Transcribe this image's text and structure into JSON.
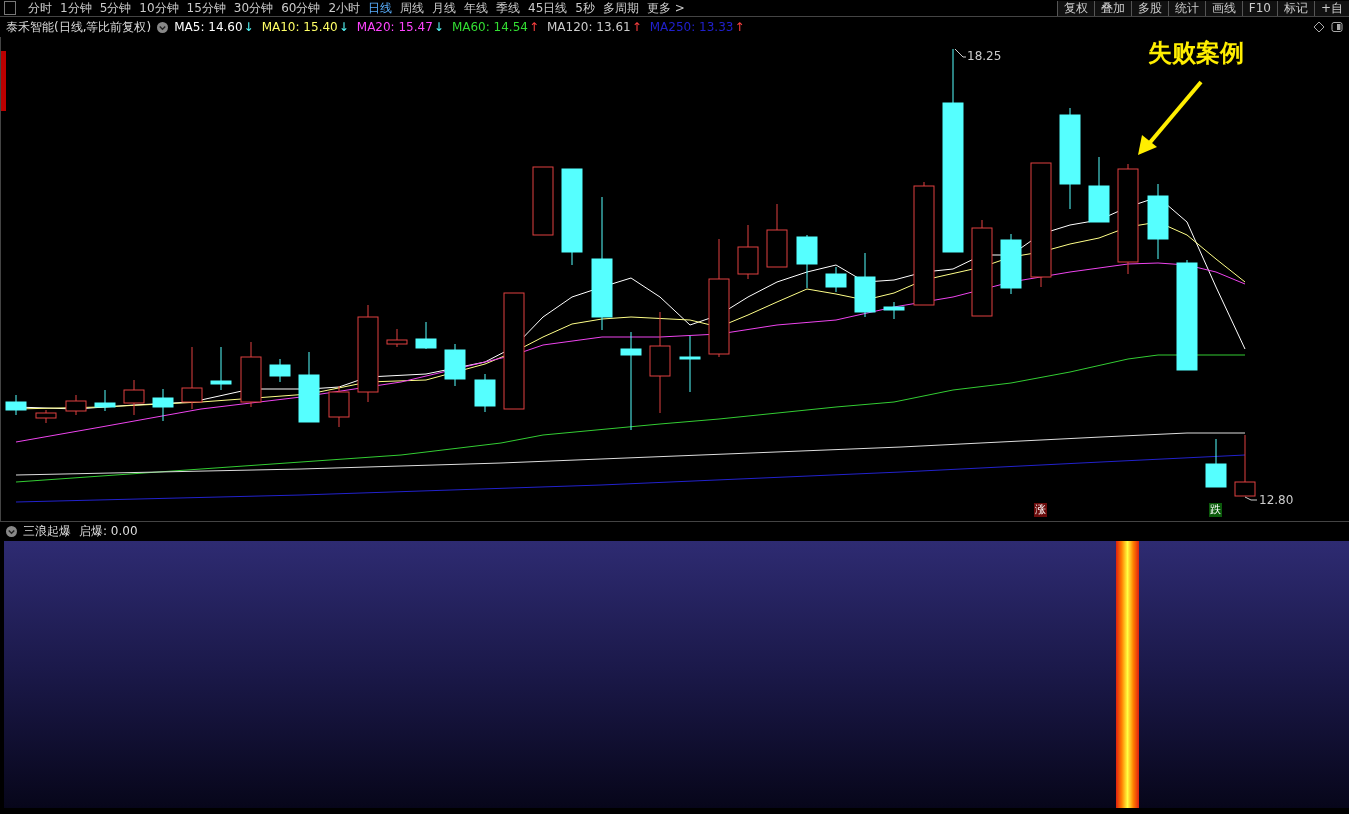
{
  "toolbar": {
    "periods": [
      {
        "label": "分时",
        "selected": false
      },
      {
        "label": "1分钟",
        "selected": false
      },
      {
        "label": "5分钟",
        "selected": false
      },
      {
        "label": "10分钟",
        "selected": false
      },
      {
        "label": "15分钟",
        "selected": false
      },
      {
        "label": "30分钟",
        "selected": false
      },
      {
        "label": "60分钟",
        "selected": false
      },
      {
        "label": "2小时",
        "selected": false
      },
      {
        "label": "日线",
        "selected": true
      },
      {
        "label": "周线",
        "selected": false
      },
      {
        "label": "月线",
        "selected": false
      },
      {
        "label": "年线",
        "selected": false
      },
      {
        "label": "季线",
        "selected": false
      },
      {
        "label": "45日线",
        "selected": false
      },
      {
        "label": "5秒",
        "selected": false
      },
      {
        "label": "多周期",
        "selected": false
      },
      {
        "label": "更多 >",
        "selected": false
      }
    ],
    "tools": [
      "复权",
      "叠加",
      "多股",
      "统计",
      "画线",
      "F10",
      "标记",
      "+自"
    ]
  },
  "legend": {
    "title": "泰禾智能(日线,等比前复权)",
    "indicators": [
      {
        "label": "MA5: 14.60",
        "arrow": "↓",
        "rising": false,
        "color": "#ffffff"
      },
      {
        "label": "MA10: 15.40",
        "arrow": "↓",
        "rising": false,
        "color": "#ffff66"
      },
      {
        "label": "MA20: 15.47",
        "arrow": "↓",
        "rising": false,
        "color": "#ff44ff"
      },
      {
        "label": "MA60: 14.54",
        "arrow": "↑",
        "rising": true,
        "color": "#33dd33"
      },
      {
        "label": "MA120: 13.61",
        "arrow": "↑",
        "rising": true,
        "color": "#cccccc"
      },
      {
        "label": "MA250: 13.33",
        "arrow": "↑",
        "rising": true,
        "color": "#2020cc"
      }
    ]
  },
  "chart": {
    "high_label": "18.25",
    "low_label": "12.80",
    "annotation": "失败案例",
    "signals": [
      {
        "label": "涨",
        "kind": "rise"
      },
      {
        "label": "跌",
        "kind": "fall"
      }
    ]
  },
  "indicator": {
    "name": "三浪起爆",
    "reading": "启爆: 0.00"
  }
}
